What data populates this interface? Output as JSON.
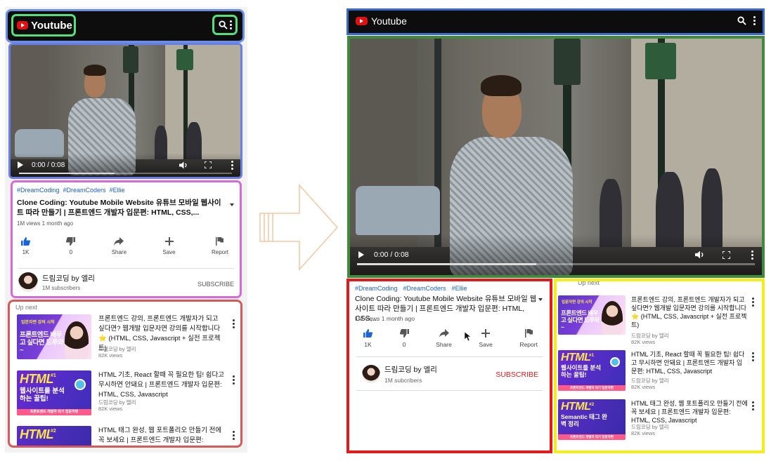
{
  "app": {
    "logo_text": "Youtube"
  },
  "header": {
    "icons": [
      "search-icon",
      "more-vert-icon"
    ]
  },
  "player": {
    "time_current": "0:00",
    "time_total": "0:08",
    "time_display": "0:00 / 0:08",
    "progress_fraction": 0.45,
    "icons": [
      "play-icon",
      "volume-icon",
      "fullscreen-icon",
      "more-vert-icon"
    ]
  },
  "video": {
    "tags": [
      "#DreamCoding",
      "#DreamCoders",
      "#Ellie"
    ],
    "title": "Clone Coding: Youtube Mobile Website 유튜브 모바일 웹사이트 따라 만들기 | 프론트엔드 개발자 입문편: HTML, CSS,...",
    "meta": "1M views 1 month ago",
    "actions": [
      {
        "label": "1K",
        "icon": "thumbs-up-icon"
      },
      {
        "label": "0",
        "icon": "thumbs-down-icon"
      },
      {
        "label": "Share",
        "icon": "share-icon"
      },
      {
        "label": "Save",
        "icon": "add-icon"
      },
      {
        "label": "Report",
        "icon": "flag-icon"
      }
    ]
  },
  "channel": {
    "name": "드림코딩 by 엘리",
    "subs_mobile": "1M subscribers",
    "subs_desktop": "1M subcribers",
    "subscribe_label": "SUBSCRIBE",
    "subscribe_label_desktop": "SUBSCRIBE"
  },
  "up_next": {
    "label": "Up next",
    "items": [
      {
        "title": "프론트엔드 강의, 프론트엔드 개발자가 되고 싶다면? 웹개발 입문자면 강의를 시작합니다 ⭐ (HTML, CSS, Javascript + 실전 프로젝트)",
        "channel": "드림코딩 by 엘리",
        "views": "82K views",
        "thumb_big": "프론트엔드 배우고 싶다면 드루와~",
        "thumb_sub": "입문자면 강의 시작"
      },
      {
        "title": "HTML 기초, React 할때 꼭 필요한 팁! 쉽다고 무시하면 안돼요 | 프론트엔드 개발자 입문편: HTML, CSS, Javascript",
        "channel": "드림코딩 by 엘리",
        "views": "82K views",
        "thumb_big": "HTML",
        "thumb_num": "#1",
        "thumb_sub": "웹사이트를 분석 하는 꿀팁!",
        "thumb_band": "프론트엔드 개발자 되기 입문자편"
      },
      {
        "title": "HTML 태그 완성, 웹 포트폴리오 만들기 전에 꼭 보세요 | 프론트엔드 개발자 입문편: HTML, CSS, Javascript",
        "channel": "드림코딩 by 엘리",
        "views": "82K views",
        "thumb_big": "HTML",
        "thumb_num": "#2",
        "thumb_sub": "Semantic 태그 완벽 정리",
        "thumb_band": "프론트엔드 개발자 되기 입문자편"
      }
    ]
  },
  "mobile_up_next_title_3": "HTML 태그 완성, 웹 포트폴리오 만들기 전에 꼭 보세요 | 프론트엔드 개발자 입문편: HTML,...",
  "colors": {
    "mobile_header_outline": "#6a8ee3",
    "mobile_logo_outline": "#55e07d",
    "mobile_video_outline": "#6a7ee8",
    "mobile_info_outline": "#d66ad6",
    "mobile_upnext_outline": "#d65a5a",
    "desktop_header_outline": "#3a6ac8",
    "desktop_video_outline": "#3f8a3f",
    "desktop_info_outline": "#e41a1a",
    "desktop_upnext_outline": "#f2ee1a",
    "subscribe_red": "#e41a1a",
    "tag_blue": "#1c5fcf",
    "arrow": "#f5c7a1"
  }
}
